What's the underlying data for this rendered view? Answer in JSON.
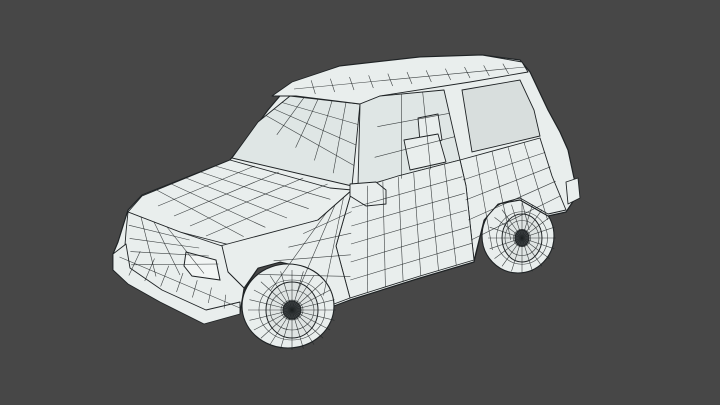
{
  "viewport": {
    "background_color": "#474747",
    "model_fill": "#e9eeed",
    "glass_fill": "#dfe6e5",
    "wire_color": "#1f2325",
    "subject": "wireframe-suv-model"
  }
}
